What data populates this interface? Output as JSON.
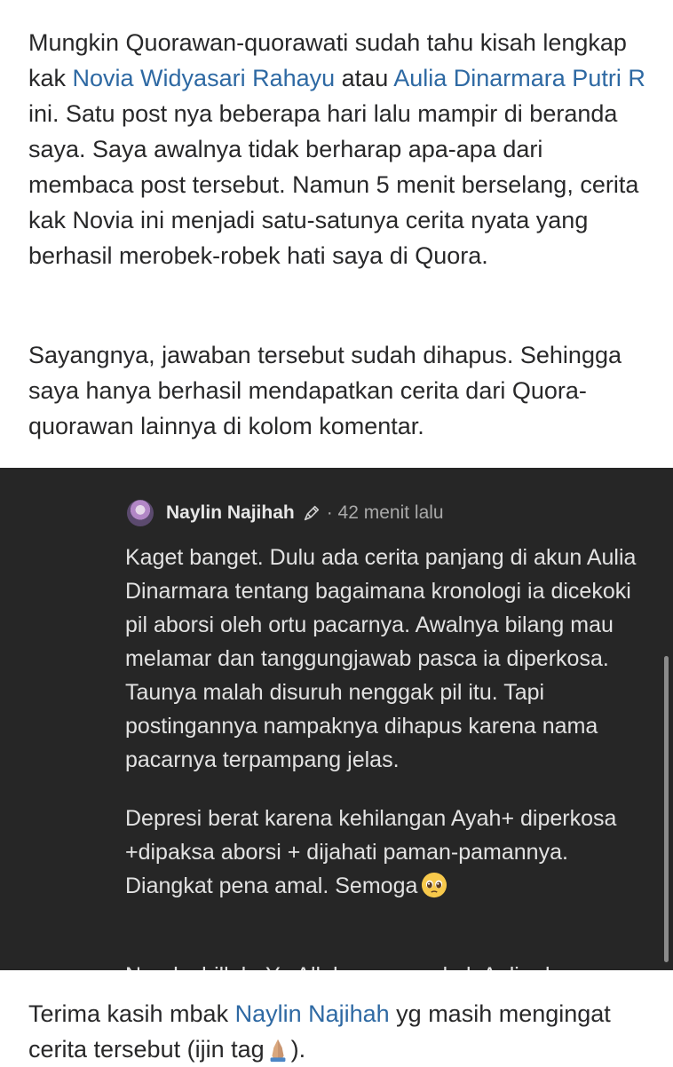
{
  "para1": {
    "before": "Mungkin Quorawan-quorawati sudah tahu kisah lengkap kak ",
    "mention1": "Novia Widyasari Rahayu",
    "between": " atau ",
    "mention2": "Aulia Dinarmara Putri R",
    "after": " ini. Satu post nya beberapa hari lalu mampir di beranda saya. Saya awalnya tidak berharap apa-apa dari membaca post tersebut. Namun 5 menit berselang, cerita kak Novia ini menjadi satu-satunya cerita nyata yang berhasil merobek-robek hati saya di Quora."
  },
  "para2": "Sayangnya, jawaban tersebut sudah dihapus. Sehingga saya hanya berhasil mendapatkan cerita dari Quora-quorawan lainnya di kolom komentar.",
  "comment": {
    "author": "Naylin Najihah",
    "time": "· 42 menit lalu",
    "body1": "Kaget banget. Dulu ada cerita panjang di akun Aulia Dinarmara tentang bagaimana kronologi ia dicekoki pil aborsi oleh ortu pacarnya. Awalnya bilang mau melamar dan tanggungjawab pasca ia diperkosa. Taunya malah disuruh nenggak pil itu. Tapi postingannya nampaknya dihapus karena nama pacarnya terpampang jelas.",
    "body2": "Depresi berat karena kehilangan Ayah+ diperkosa +dipaksa aborsi + dijahati paman-pamannya. Diangkat pena amal. Semoga",
    "partial_line": "Naudzubillah, Ya Allah, semoga kak Aulia dan"
  },
  "para3": {
    "before": "Terima kasih mbak ",
    "mention": "Naylin Najihah",
    "after": " yg masih mengingat cerita tersebut (ijin tag",
    "end": ")."
  },
  "icons": {
    "pen": "pen-icon",
    "emoji_pleading": "pleading-face-icon",
    "emoji_pray": "folded-hands-icon"
  },
  "colors": {
    "link": "#2e69a3",
    "screenshot_bg": "#262626"
  }
}
